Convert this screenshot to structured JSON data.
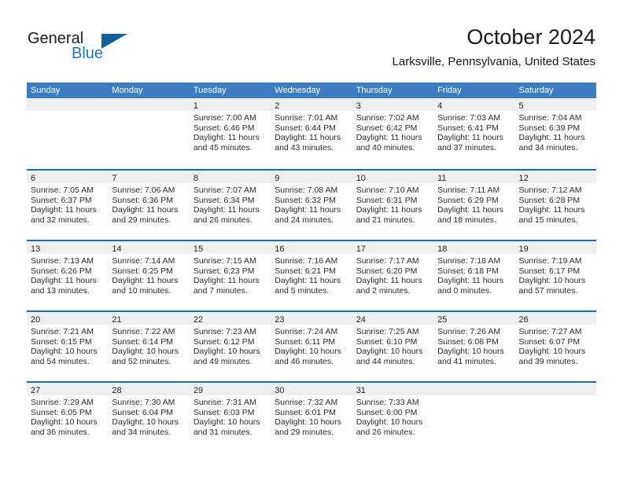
{
  "brand": {
    "name_part1": "General",
    "name_part2": "Blue",
    "accent_color": "#1c77c3",
    "triangle_color": "#135f9e"
  },
  "header": {
    "month_title": "October 2024",
    "location": "Larksville, Pennsylvania, United States"
  },
  "theme": {
    "header_row_bg": "#3b7dc0",
    "row_divider": "#1b6cb0",
    "day_band_bg": "#efefef",
    "text_color": "#2b2b2b"
  },
  "weekdays": [
    "Sunday",
    "Monday",
    "Tuesday",
    "Wednesday",
    "Thursday",
    "Friday",
    "Saturday"
  ],
  "weeks": [
    [
      {
        "day": "",
        "sunrise": "",
        "sunset": "",
        "daylight1": "",
        "daylight2": "",
        "empty": true
      },
      {
        "day": "",
        "sunrise": "",
        "sunset": "",
        "daylight1": "",
        "daylight2": "",
        "empty": true
      },
      {
        "day": "1",
        "sunrise": "Sunrise: 7:00 AM",
        "sunset": "Sunset: 6:46 PM",
        "daylight1": "Daylight: 11 hours",
        "daylight2": "and 45 minutes."
      },
      {
        "day": "2",
        "sunrise": "Sunrise: 7:01 AM",
        "sunset": "Sunset: 6:44 PM",
        "daylight1": "Daylight: 11 hours",
        "daylight2": "and 43 minutes."
      },
      {
        "day": "3",
        "sunrise": "Sunrise: 7:02 AM",
        "sunset": "Sunset: 6:42 PM",
        "daylight1": "Daylight: 11 hours",
        "daylight2": "and 40 minutes."
      },
      {
        "day": "4",
        "sunrise": "Sunrise: 7:03 AM",
        "sunset": "Sunset: 6:41 PM",
        "daylight1": "Daylight: 11 hours",
        "daylight2": "and 37 minutes."
      },
      {
        "day": "5",
        "sunrise": "Sunrise: 7:04 AM",
        "sunset": "Sunset: 6:39 PM",
        "daylight1": "Daylight: 11 hours",
        "daylight2": "and 34 minutes."
      }
    ],
    [
      {
        "day": "6",
        "sunrise": "Sunrise: 7:05 AM",
        "sunset": "Sunset: 6:37 PM",
        "daylight1": "Daylight: 11 hours",
        "daylight2": "and 32 minutes."
      },
      {
        "day": "7",
        "sunrise": "Sunrise: 7:06 AM",
        "sunset": "Sunset: 6:36 PM",
        "daylight1": "Daylight: 11 hours",
        "daylight2": "and 29 minutes."
      },
      {
        "day": "8",
        "sunrise": "Sunrise: 7:07 AM",
        "sunset": "Sunset: 6:34 PM",
        "daylight1": "Daylight: 11 hours",
        "daylight2": "and 26 minutes."
      },
      {
        "day": "9",
        "sunrise": "Sunrise: 7:08 AM",
        "sunset": "Sunset: 6:32 PM",
        "daylight1": "Daylight: 11 hours",
        "daylight2": "and 24 minutes."
      },
      {
        "day": "10",
        "sunrise": "Sunrise: 7:10 AM",
        "sunset": "Sunset: 6:31 PM",
        "daylight1": "Daylight: 11 hours",
        "daylight2": "and 21 minutes."
      },
      {
        "day": "11",
        "sunrise": "Sunrise: 7:11 AM",
        "sunset": "Sunset: 6:29 PM",
        "daylight1": "Daylight: 11 hours",
        "daylight2": "and 18 minutes."
      },
      {
        "day": "12",
        "sunrise": "Sunrise: 7:12 AM",
        "sunset": "Sunset: 6:28 PM",
        "daylight1": "Daylight: 11 hours",
        "daylight2": "and 15 minutes."
      }
    ],
    [
      {
        "day": "13",
        "sunrise": "Sunrise: 7:13 AM",
        "sunset": "Sunset: 6:26 PM",
        "daylight1": "Daylight: 11 hours",
        "daylight2": "and 13 minutes."
      },
      {
        "day": "14",
        "sunrise": "Sunrise: 7:14 AM",
        "sunset": "Sunset: 6:25 PM",
        "daylight1": "Daylight: 11 hours",
        "daylight2": "and 10 minutes."
      },
      {
        "day": "15",
        "sunrise": "Sunrise: 7:15 AM",
        "sunset": "Sunset: 6:23 PM",
        "daylight1": "Daylight: 11 hours",
        "daylight2": "and 7 minutes."
      },
      {
        "day": "16",
        "sunrise": "Sunrise: 7:16 AM",
        "sunset": "Sunset: 6:21 PM",
        "daylight1": "Daylight: 11 hours",
        "daylight2": "and 5 minutes."
      },
      {
        "day": "17",
        "sunrise": "Sunrise: 7:17 AM",
        "sunset": "Sunset: 6:20 PM",
        "daylight1": "Daylight: 11 hours",
        "daylight2": "and 2 minutes."
      },
      {
        "day": "18",
        "sunrise": "Sunrise: 7:18 AM",
        "sunset": "Sunset: 6:18 PM",
        "daylight1": "Daylight: 11 hours",
        "daylight2": "and 0 minutes."
      },
      {
        "day": "19",
        "sunrise": "Sunrise: 7:19 AM",
        "sunset": "Sunset: 6:17 PM",
        "daylight1": "Daylight: 10 hours",
        "daylight2": "and 57 minutes."
      }
    ],
    [
      {
        "day": "20",
        "sunrise": "Sunrise: 7:21 AM",
        "sunset": "Sunset: 6:15 PM",
        "daylight1": "Daylight: 10 hours",
        "daylight2": "and 54 minutes."
      },
      {
        "day": "21",
        "sunrise": "Sunrise: 7:22 AM",
        "sunset": "Sunset: 6:14 PM",
        "daylight1": "Daylight: 10 hours",
        "daylight2": "and 52 minutes."
      },
      {
        "day": "22",
        "sunrise": "Sunrise: 7:23 AM",
        "sunset": "Sunset: 6:12 PM",
        "daylight1": "Daylight: 10 hours",
        "daylight2": "and 49 minutes."
      },
      {
        "day": "23",
        "sunrise": "Sunrise: 7:24 AM",
        "sunset": "Sunset: 6:11 PM",
        "daylight1": "Daylight: 10 hours",
        "daylight2": "and 46 minutes."
      },
      {
        "day": "24",
        "sunrise": "Sunrise: 7:25 AM",
        "sunset": "Sunset: 6:10 PM",
        "daylight1": "Daylight: 10 hours",
        "daylight2": "and 44 minutes."
      },
      {
        "day": "25",
        "sunrise": "Sunrise: 7:26 AM",
        "sunset": "Sunset: 6:08 PM",
        "daylight1": "Daylight: 10 hours",
        "daylight2": "and 41 minutes."
      },
      {
        "day": "26",
        "sunrise": "Sunrise: 7:27 AM",
        "sunset": "Sunset: 6:07 PM",
        "daylight1": "Daylight: 10 hours",
        "daylight2": "and 39 minutes."
      }
    ],
    [
      {
        "day": "27",
        "sunrise": "Sunrise: 7:29 AM",
        "sunset": "Sunset: 6:05 PM",
        "daylight1": "Daylight: 10 hours",
        "daylight2": "and 36 minutes."
      },
      {
        "day": "28",
        "sunrise": "Sunrise: 7:30 AM",
        "sunset": "Sunset: 6:04 PM",
        "daylight1": "Daylight: 10 hours",
        "daylight2": "and 34 minutes."
      },
      {
        "day": "29",
        "sunrise": "Sunrise: 7:31 AM",
        "sunset": "Sunset: 6:03 PM",
        "daylight1": "Daylight: 10 hours",
        "daylight2": "and 31 minutes."
      },
      {
        "day": "30",
        "sunrise": "Sunrise: 7:32 AM",
        "sunset": "Sunset: 6:01 PM",
        "daylight1": "Daylight: 10 hours",
        "daylight2": "and 29 minutes."
      },
      {
        "day": "31",
        "sunrise": "Sunrise: 7:33 AM",
        "sunset": "Sunset: 6:00 PM",
        "daylight1": "Daylight: 10 hours",
        "daylight2": "and 26 minutes."
      },
      {
        "day": "",
        "sunrise": "",
        "sunset": "",
        "daylight1": "",
        "daylight2": "",
        "empty": true
      },
      {
        "day": "",
        "sunrise": "",
        "sunset": "",
        "daylight1": "",
        "daylight2": "",
        "empty": true
      }
    ]
  ]
}
